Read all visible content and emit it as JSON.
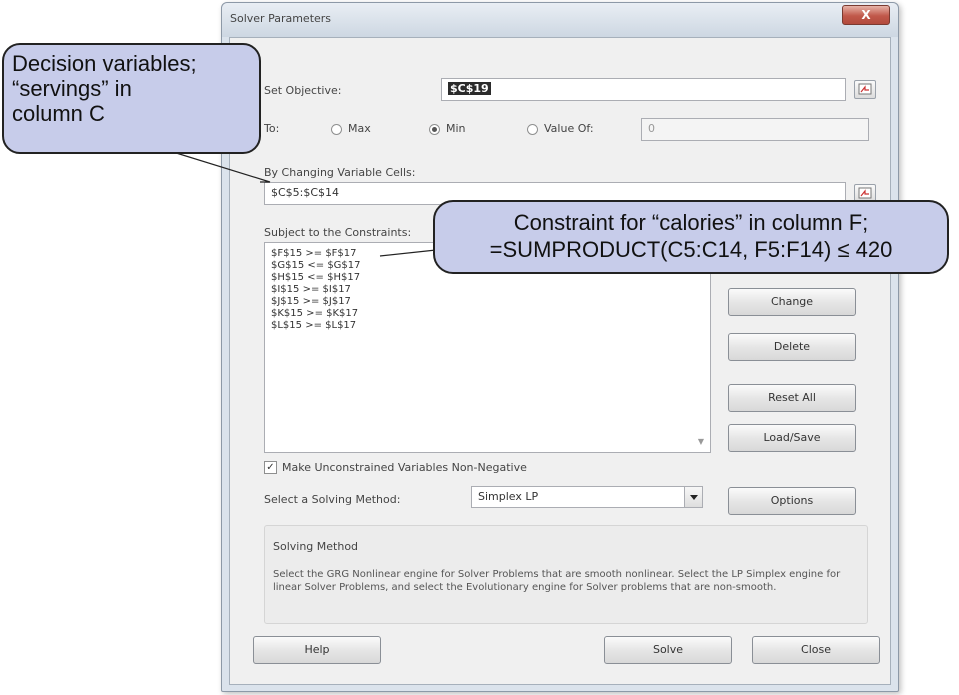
{
  "window": {
    "title": "Solver Parameters",
    "close_label": "X"
  },
  "objective": {
    "label": "Set Objective:",
    "value": "$C$19"
  },
  "to": {
    "label": "To:",
    "options": [
      {
        "label": "Max",
        "selected": false
      },
      {
        "label": "Min",
        "selected": true
      },
      {
        "label": "Value Of:",
        "selected": false
      }
    ],
    "value_of": "0"
  },
  "changing": {
    "label": "By Changing Variable Cells:",
    "value": "$C$5:$C$14"
  },
  "constraints": {
    "label": "Subject to the Constraints:",
    "items": [
      "$F$15 >= $F$17",
      "$G$15 <= $G$17",
      "$H$15 <= $H$17",
      "$I$15 >= $I$17",
      "$J$15 >= $J$17",
      "$K$15 >= $K$17",
      "$L$15 >= $L$17"
    ]
  },
  "buttons": {
    "change": "Change",
    "delete": "Delete",
    "reset_all": "Reset All",
    "load_save": "Load/Save",
    "options": "Options",
    "help": "Help",
    "solve": "Solve",
    "close": "Close"
  },
  "nonneg": {
    "label": "Make Unconstrained Variables Non-Negative",
    "checked": true
  },
  "method": {
    "label": "Select a Solving Method:",
    "value": "Simplex LP"
  },
  "solving_method": {
    "title": "Solving Method",
    "text": "Select the GRG Nonlinear engine for Solver Problems that are smooth nonlinear. Select the LP Simplex engine for linear Solver Problems, and select the Evolutionary engine for Solver problems that are non-smooth."
  },
  "callouts": {
    "decision": {
      "line1": "Decision variables;",
      "line2": "“servings” in",
      "line3": "column C"
    },
    "constraint": {
      "line1": "Constraint for “calories” in column F;",
      "line2": "=SUMPRODUCT(C5:C14, F5:F14) ≤ 420"
    }
  },
  "colors": {
    "callout_fill": "#c7ccea",
    "dialog_frame": "#dbe3ec"
  }
}
